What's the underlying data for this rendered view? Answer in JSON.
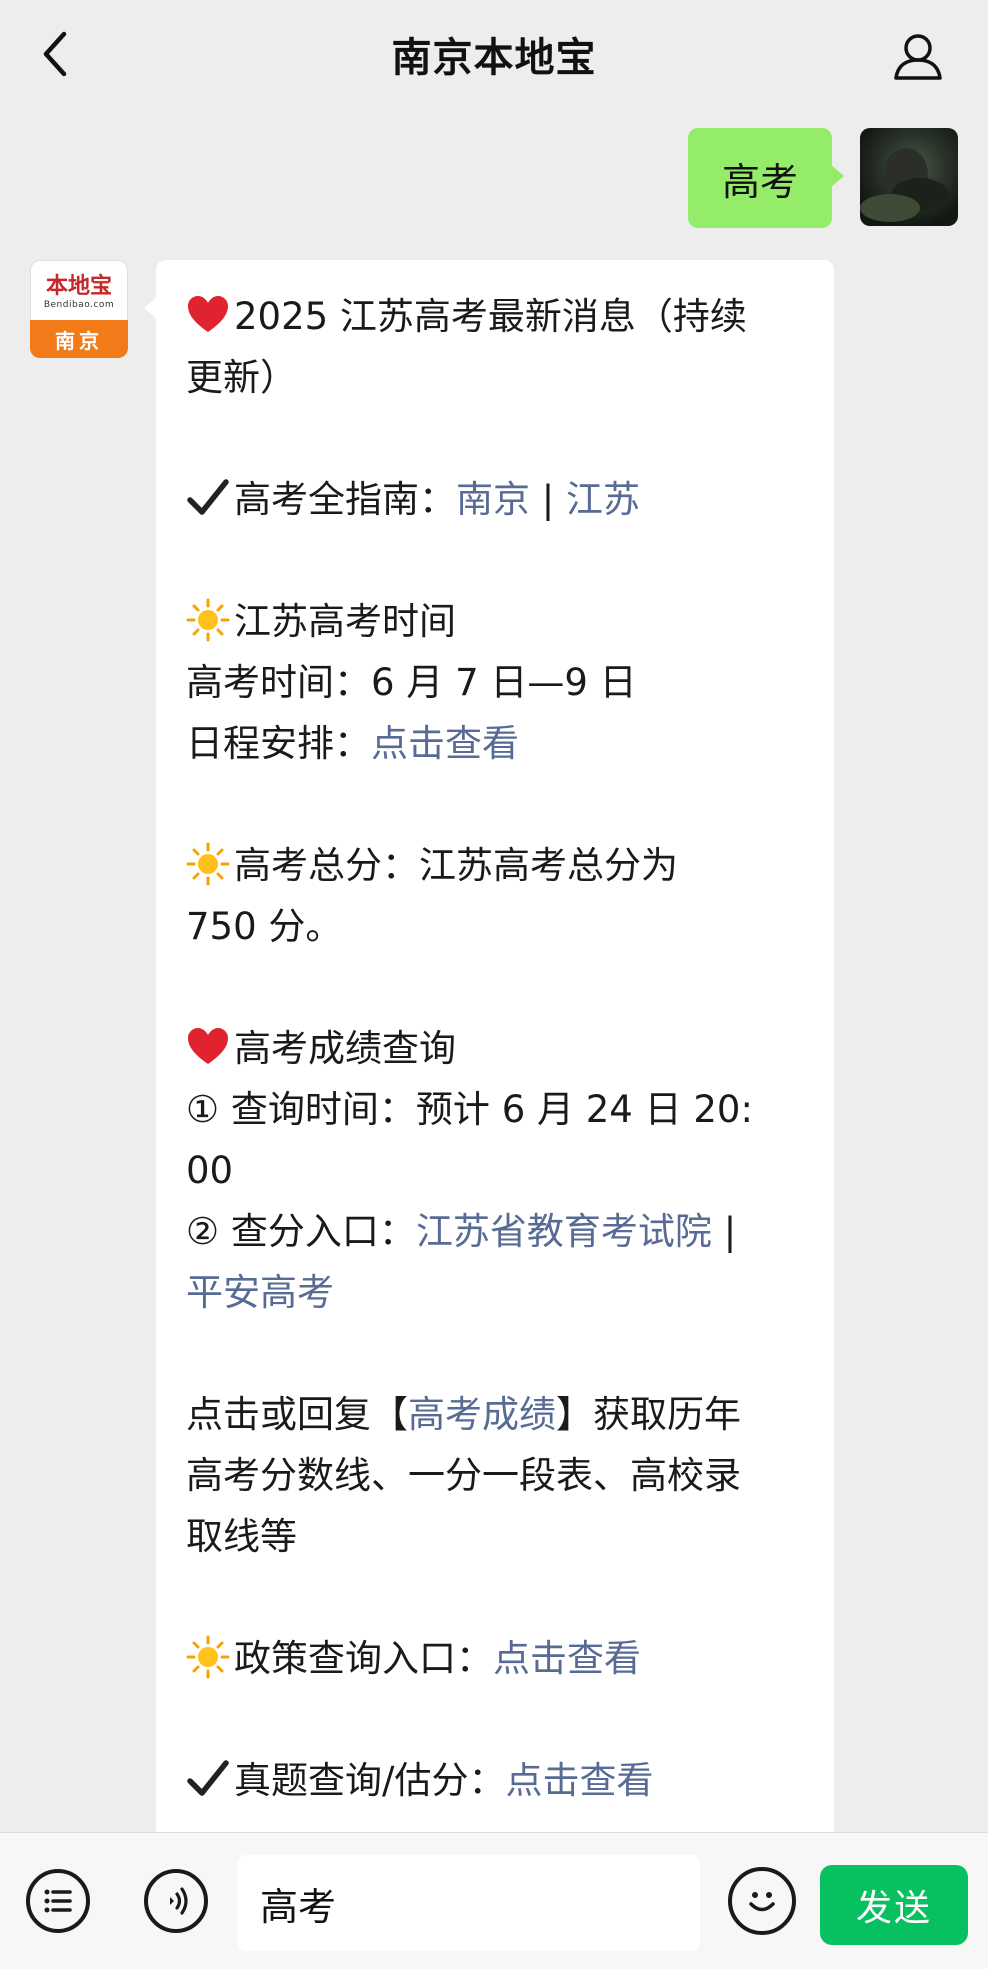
{
  "header": {
    "title": "南京本地宝"
  },
  "sent_message": {
    "text": "高考"
  },
  "bot": {
    "avatar": {
      "logo_text": "本地宝",
      "logo_sub": "Bendibao.com",
      "city": "南京"
    },
    "message": {
      "title_line1": "2025 江苏高考最新消息（持续",
      "title_line2": "更新）",
      "guide_label": "高考全指南：",
      "guide_link1": "南京",
      "guide_sep": " | ",
      "guide_link2": "江苏",
      "time_heading": "江苏高考时间",
      "exam_time": "高考时间：6 月 7 日—9 日",
      "schedule_label": "日程安排：",
      "schedule_link": "点击查看",
      "total_score_line1": "高考总分：江苏高考总分为",
      "total_score_line2": "750 分。",
      "score_query_heading": "高考成绩查询",
      "query_time_line1": "① 查询时间：预计 6 月 24 日 20:",
      "query_time_line2": "00",
      "entry_label": "② 查分入口：",
      "entry_link1": "江苏省教育考试院",
      "entry_sep": " |",
      "entry_link2": "平安高考",
      "reply_prefix": "点击或回复【",
      "reply_link": "高考成绩",
      "reply_suffix": "】获取历年",
      "reply_line2": "高考分数线、一分一段表、高校录",
      "reply_line3": "取线等",
      "policy_label": "政策查询入口：",
      "policy_link": "点击查看",
      "exam_label": "真题查询/估分：",
      "exam_link": "点击查看"
    }
  },
  "input_bar": {
    "input_value": "高考",
    "send_label": "发送"
  },
  "colors": {
    "link": "#576b95",
    "sent_bubble": "#95ec69",
    "send_button": "#07c160",
    "logo_band": "#f07b18"
  }
}
